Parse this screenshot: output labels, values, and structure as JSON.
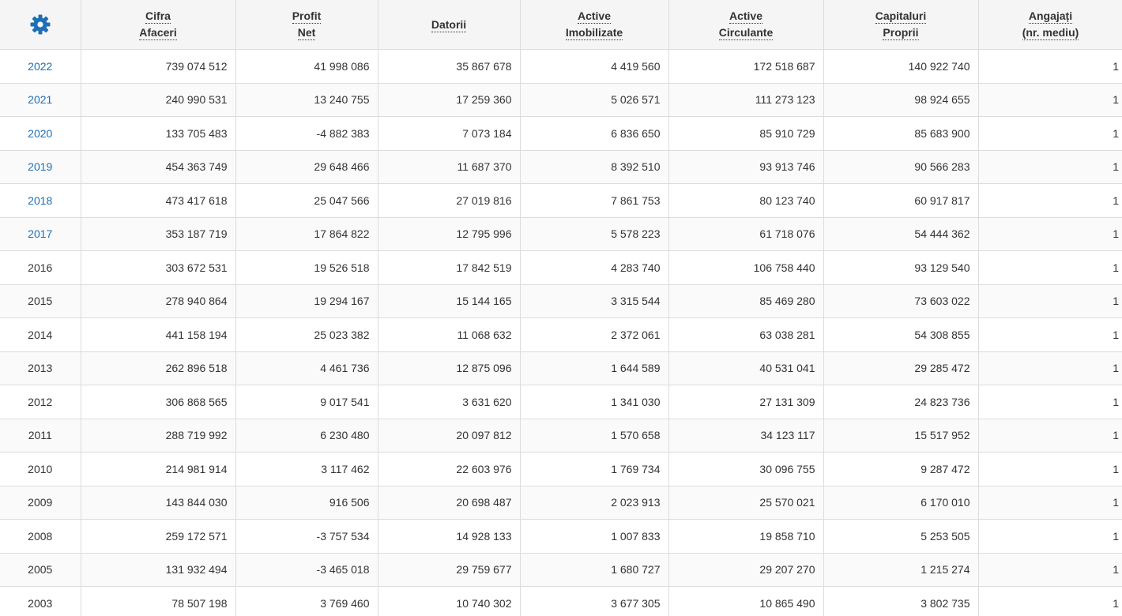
{
  "colors": {
    "link": "#1e6fb5",
    "gear": "#1e6fb5",
    "header_bg": "#f5f5f5",
    "border": "#dcdcdc"
  },
  "settings_icon": "gear-icon",
  "columns": [
    {
      "line1": "Cifra",
      "line2": "Afaceri"
    },
    {
      "line1": "Profit",
      "line2": "Net"
    },
    {
      "line1": "Datorii",
      "line2": ""
    },
    {
      "line1": "Active",
      "line2": "Imobilizate"
    },
    {
      "line1": "Active",
      "line2": "Circulante"
    },
    {
      "line1": "Capitaluri",
      "line2": "Proprii"
    },
    {
      "line1": "Angajați",
      "line2": "(nr. mediu)"
    }
  ],
  "rows": [
    {
      "year": "2022",
      "link": true,
      "values": [
        "739 074 512",
        "41 998 086",
        "35 867 678",
        "4 419 560",
        "172 518 687",
        "140 922 740",
        "1"
      ]
    },
    {
      "year": "2021",
      "link": true,
      "values": [
        "240 990 531",
        "13 240 755",
        "17 259 360",
        "5 026 571",
        "111 273 123",
        "98 924 655",
        "1"
      ]
    },
    {
      "year": "2020",
      "link": true,
      "values": [
        "133 705 483",
        "-4 882 383",
        "7 073 184",
        "6 836 650",
        "85 910 729",
        "85 683 900",
        "1"
      ]
    },
    {
      "year": "2019",
      "link": true,
      "values": [
        "454 363 749",
        "29 648 466",
        "11 687 370",
        "8 392 510",
        "93 913 746",
        "90 566 283",
        "1"
      ]
    },
    {
      "year": "2018",
      "link": true,
      "values": [
        "473 417 618",
        "25 047 566",
        "27 019 816",
        "7 861 753",
        "80 123 740",
        "60 917 817",
        "1"
      ]
    },
    {
      "year": "2017",
      "link": true,
      "values": [
        "353 187 719",
        "17 864 822",
        "12 795 996",
        "5 578 223",
        "61 718 076",
        "54 444 362",
        "1"
      ]
    },
    {
      "year": "2016",
      "link": false,
      "values": [
        "303 672 531",
        "19 526 518",
        "17 842 519",
        "4 283 740",
        "106 758 440",
        "93 129 540",
        "1"
      ]
    },
    {
      "year": "2015",
      "link": false,
      "values": [
        "278 940 864",
        "19 294 167",
        "15 144 165",
        "3 315 544",
        "85 469 280",
        "73 603 022",
        "1"
      ]
    },
    {
      "year": "2014",
      "link": false,
      "values": [
        "441 158 194",
        "25 023 382",
        "11 068 632",
        "2 372 061",
        "63 038 281",
        "54 308 855",
        "1"
      ]
    },
    {
      "year": "2013",
      "link": false,
      "values": [
        "262 896 518",
        "4 461 736",
        "12 875 096",
        "1 644 589",
        "40 531 041",
        "29 285 472",
        "1"
      ]
    },
    {
      "year": "2012",
      "link": false,
      "values": [
        "306 868 565",
        "9 017 541",
        "3 631 620",
        "1 341 030",
        "27 131 309",
        "24 823 736",
        "1"
      ]
    },
    {
      "year": "2011",
      "link": false,
      "values": [
        "288 719 992",
        "6 230 480",
        "20 097 812",
        "1 570 658",
        "34 123 117",
        "15 517 952",
        "1"
      ]
    },
    {
      "year": "2010",
      "link": false,
      "values": [
        "214 981 914",
        "3 117 462",
        "22 603 976",
        "1 769 734",
        "30 096 755",
        "9 287 472",
        "1"
      ]
    },
    {
      "year": "2009",
      "link": false,
      "values": [
        "143 844 030",
        "916 506",
        "20 698 487",
        "2 023 913",
        "25 570 021",
        "6 170 010",
        "1"
      ]
    },
    {
      "year": "2008",
      "link": false,
      "values": [
        "259 172 571",
        "-3 757 534",
        "14 928 133",
        "1 007 833",
        "19 858 710",
        "5 253 505",
        "1"
      ]
    },
    {
      "year": "2005",
      "link": false,
      "values": [
        "131 932 494",
        "-3 465 018",
        "29 759 677",
        "1 680 727",
        "29 207 270",
        "1 215 274",
        "1"
      ]
    },
    {
      "year": "2003",
      "link": false,
      "values": [
        "78 507 198",
        "3 769 460",
        "10 740 302",
        "3 677 305",
        "10 865 490",
        "3 802 735",
        "1"
      ]
    }
  ]
}
